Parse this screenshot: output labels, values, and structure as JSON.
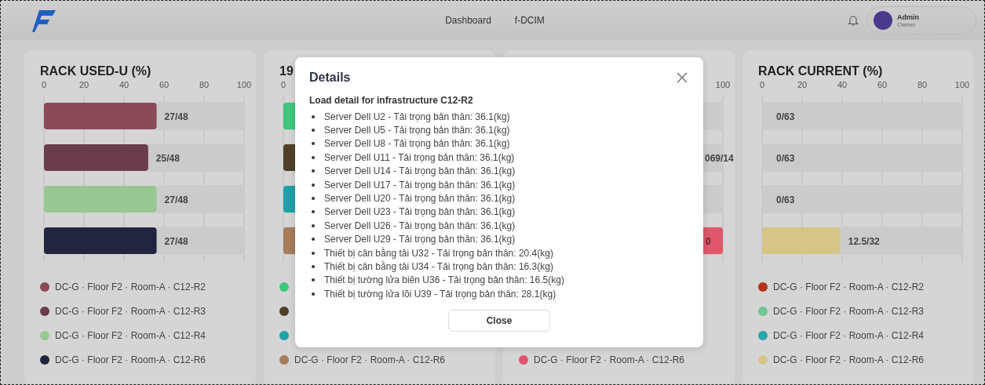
{
  "header": {
    "nav": [
      {
        "label": "Dashboard"
      },
      {
        "label": "f-DCIM"
      }
    ],
    "user": {
      "name": "Admin",
      "role": "Owner"
    }
  },
  "cards": [
    {
      "kind": "chart",
      "title": "RACK USED-U (%)",
      "chart_data": {
        "type": "bar",
        "orientation": "horizontal",
        "xlim": [
          0,
          100
        ],
        "xticks": [
          0,
          20,
          40,
          60,
          80,
          100
        ],
        "grid": true,
        "values": [
          56.3,
          52.1,
          56.3,
          56.3
        ],
        "value_labels": [
          "27/48",
          "25/48",
          "27/48",
          "27/48"
        ]
      },
      "legend": [
        {
          "text": "DC-G · Floor F2 · Room-A · C12-R2",
          "color": "#8b4a59"
        },
        {
          "text": "DC-G · Floor F2 · Room-A · C12-R3",
          "color": "#6a3d4c"
        },
        {
          "text": "DC-G · Floor F2 · Room-A · C12-R4",
          "color": "#98c794"
        },
        {
          "text": "DC-G · Floor F2 · Room-A · C12-R6",
          "color": "#23253f"
        }
      ]
    },
    {
      "kind": "partial",
      "title": "19",
      "xticks": [
        {
          "kind": "start",
          "label": "0"
        }
      ],
      "rows": [
        {
          "kind": "stub",
          "color": "#3ec77d"
        },
        {
          "kind": "stub",
          "color": "#4e4128"
        },
        {
          "kind": "stub",
          "color": "#21a0aa"
        },
        {
          "kind": "stub",
          "color": "#a77c5a"
        }
      ],
      "legend": [
        {
          "color": "#3ec77d"
        },
        {
          "color": "#4e4128"
        },
        {
          "color": "#21a0aa"
        },
        {
          "text": "DC-G · Floor F2 · Room-A · C12-R6",
          "color": "#a77c5a"
        }
      ]
    },
    {
      "kind": "partial",
      "xticks": [
        {
          "kind": "end",
          "label": "100"
        }
      ],
      "rows": [
        {
          "kind": "track"
        },
        {
          "kind": "label",
          "label": "069/14"
        },
        {
          "kind": "track"
        },
        {
          "kind": "full",
          "color": "#e0556b",
          "label": "0"
        }
      ],
      "legend": [
        {
          "text": "DC-G · Floor F2 · Room-A · C12-R6",
          "color": "#e0556b"
        }
      ]
    },
    {
      "kind": "chart",
      "title": "RACK CURRENT (%)",
      "chart_data": {
        "type": "bar",
        "orientation": "horizontal",
        "xlim": [
          0,
          100
        ],
        "xticks": [
          0,
          20,
          40,
          60,
          80,
          100
        ],
        "grid": true,
        "values": [
          0,
          0,
          0,
          39.1
        ],
        "value_labels": [
          "0/63",
          "0/63",
          "0/63",
          "12.5/32"
        ]
      },
      "legend": [
        {
          "text": "DC-G · Floor F2 · Room-A · C12-R2",
          "color": "#b3341b"
        },
        {
          "text": "DC-G · Floor F2 · Room-A · C12-R3",
          "color": "#6ec994"
        },
        {
          "text": "DC-G · Floor F2 · Room-A · C12-R4",
          "color": "#2aa5a7"
        },
        {
          "text": "DC-G · Floor F2 · Room-A · C12-R6",
          "color": "#d6c488"
        }
      ]
    }
  ],
  "modal": {
    "title": "Details",
    "subtitle": "Load detail for infrastructure C12-R2",
    "items": [
      "Server Dell U2 - Tải trọng bản thân: 36.1(kg)",
      "Server Dell U5 - Tải trọng bản thân: 36.1(kg)",
      "Server Dell U8 - Tải trọng bản thân: 36.1(kg)",
      "Server Dell U11 - Tải trọng bản thân: 36.1(kg)",
      "Server Dell U14 - Tải trọng bản thân: 36.1(kg)",
      "Server Dell U17 - Tải trọng bản thân: 36.1(kg)",
      "Server Dell U20 - Tải trọng bản thân: 36.1(kg)",
      "Server Dell U23 - Tải trọng bản thân: 36.1(kg)",
      "Server Dell U26 - Tải trọng bản thân: 36.1(kg)",
      "Server Dell U29 - Tải trọng bản thân: 36.1(kg)",
      "Thiết bị cân bằng tải U32 - Tải trọng bản thân: 20.4(kg)",
      "Thiết bị cân bằng tải U34 - Tải trọng bản thân: 16.3(kg)",
      "Thiết bị tường lửa biên U36 - Tải trọng bản thân: 16.5(kg)",
      "Thiết bị tường lửa lõi U39 - Tải trọng bản thân: 28.1(kg)"
    ],
    "button": "Close"
  }
}
